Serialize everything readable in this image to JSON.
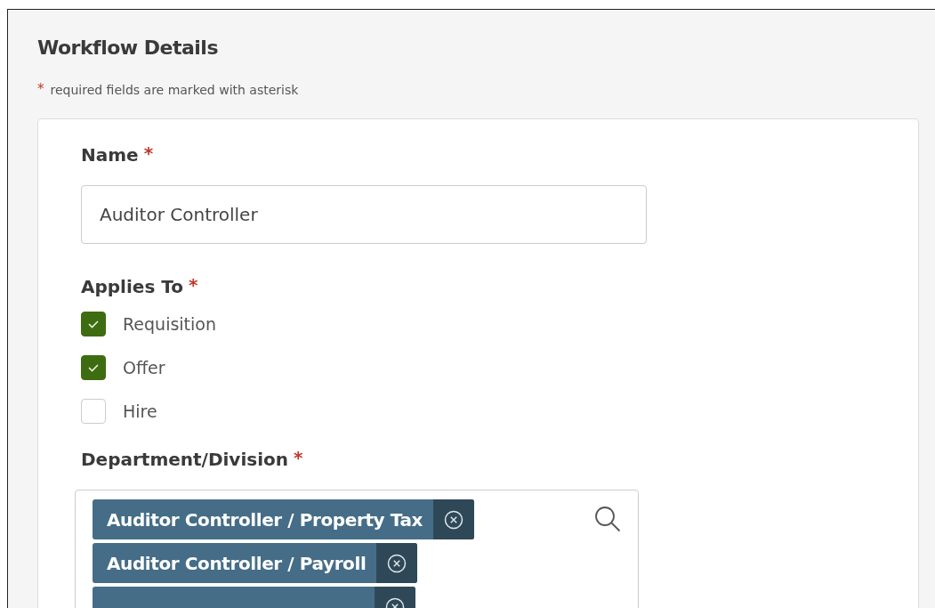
{
  "section": {
    "title": "Workflow Details",
    "required_note": "required fields are marked with asterisk",
    "required_mark": "*"
  },
  "name_field": {
    "label": "Name",
    "required_mark": "*",
    "value": "Auditor Controller"
  },
  "applies_to": {
    "label": "Applies To",
    "required_mark": "*",
    "options": [
      {
        "label": "Requisition",
        "checked": true
      },
      {
        "label": "Offer",
        "checked": true
      },
      {
        "label": "Hire",
        "checked": false
      }
    ]
  },
  "department": {
    "label": "Department/Division",
    "required_mark": "*",
    "tags": [
      {
        "kind": "full",
        "label": "Auditor Controller / Property Tax"
      },
      {
        "kind": "full",
        "label": "Auditor Controller / Payroll"
      },
      {
        "kind": "partial"
      }
    ]
  }
}
